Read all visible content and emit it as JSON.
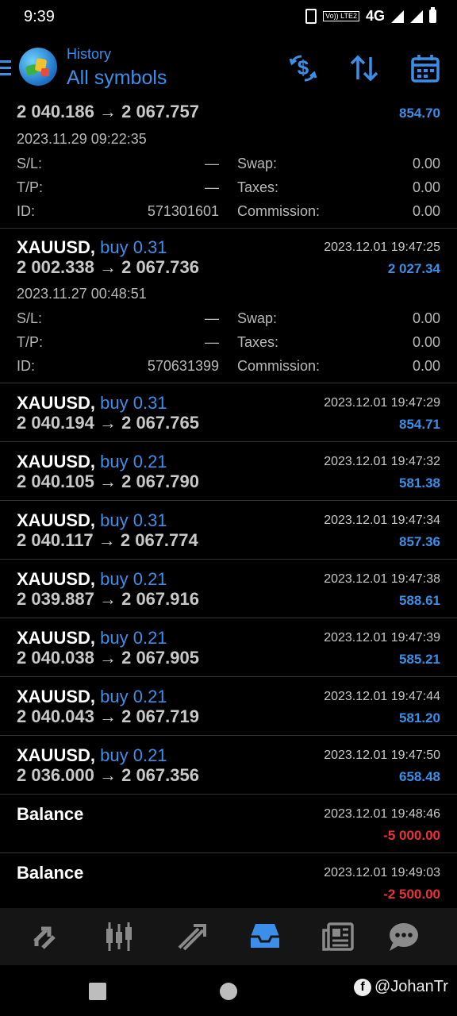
{
  "status_bar": {
    "time": "9:39",
    "lte_label": "Vo)) LTE2",
    "network": "4G"
  },
  "header": {
    "subtitle": "History",
    "title": "All symbols"
  },
  "top_row": {
    "prices": "2 040.186 → 2 067.757",
    "profit": "854.70",
    "open_time": "2023.11.29 09:22:35",
    "sl_label": "S/L:",
    "sl_value": "—",
    "tp_label": "T/P:",
    "tp_value": "—",
    "id_label": "ID:",
    "id_value": "571301601",
    "swap_label": "Swap:",
    "swap_value": "0.00",
    "taxes_label": "Taxes:",
    "taxes_value": "0.00",
    "commission_label": "Commission:",
    "commission_value": "0.00"
  },
  "expanded_row": {
    "symbol": "XAUUSD,",
    "side": "buy 0.31",
    "prices": "2 002.338 → 2 067.736",
    "close_time": "2023.12.01 19:47:25",
    "profit": "2 027.34",
    "open_time": "2023.11.27 00:48:51",
    "sl_label": "S/L:",
    "sl_value": "—",
    "tp_label": "T/P:",
    "tp_value": "—",
    "id_label": "ID:",
    "id_value": "570631399",
    "swap_label": "Swap:",
    "swap_value": "0.00",
    "taxes_label": "Taxes:",
    "taxes_value": "0.00",
    "commission_label": "Commission:",
    "commission_value": "0.00"
  },
  "deals": [
    {
      "symbol": "XAUUSD,",
      "side": "buy 0.31",
      "prices": "2 040.194 → 2 067.765",
      "time": "2023.12.01 19:47:29",
      "profit": "854.71"
    },
    {
      "symbol": "XAUUSD,",
      "side": "buy 0.21",
      "prices": "2 040.105 → 2 067.790",
      "time": "2023.12.01 19:47:32",
      "profit": "581.38"
    },
    {
      "symbol": "XAUUSD,",
      "side": "buy 0.31",
      "prices": "2 040.117 → 2 067.774",
      "time": "2023.12.01 19:47:34",
      "profit": "857.36"
    },
    {
      "symbol": "XAUUSD,",
      "side": "buy 0.21",
      "prices": "2 039.887 → 2 067.916",
      "time": "2023.12.01 19:47:38",
      "profit": "588.61"
    },
    {
      "symbol": "XAUUSD,",
      "side": "buy 0.21",
      "prices": "2 040.038 → 2 067.905",
      "time": "2023.12.01 19:47:39",
      "profit": "585.21"
    },
    {
      "symbol": "XAUUSD,",
      "side": "buy 0.21",
      "prices": "2 040.043 → 2 067.719",
      "time": "2023.12.01 19:47:44",
      "profit": "581.20"
    },
    {
      "symbol": "XAUUSD,",
      "side": "buy 0.21",
      "prices": "2 036.000 → 2 067.356",
      "time": "2023.12.01 19:47:50",
      "profit": "658.48"
    }
  ],
  "balances": [
    {
      "label": "Balance",
      "time": "2023.12.01 19:48:46",
      "amount": "-5 000.00"
    },
    {
      "label": "Balance",
      "time": "2023.12.01 19:49:03",
      "amount": "-2 500.00"
    }
  ],
  "bottom_nav": {
    "icons": [
      "quotes-icon",
      "chart-icon",
      "trade-icon",
      "history-icon",
      "news-icon",
      "chat-icon"
    ],
    "active": "history-icon"
  },
  "watermark": {
    "text": "@JohanTr"
  },
  "colors": {
    "accent": "#3b8fe8",
    "negative": "#e8323a",
    "background": "#000000",
    "nav_bg": "#151515"
  }
}
